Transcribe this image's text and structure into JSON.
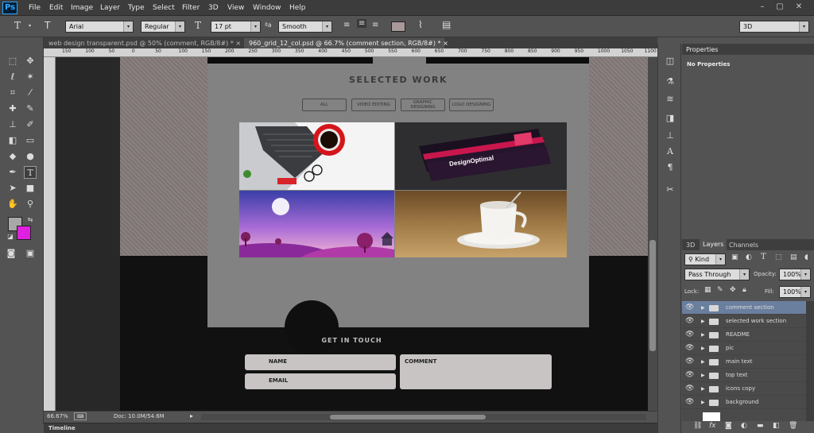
{
  "app": {
    "logo": "Ps"
  },
  "menu": [
    "File",
    "Edit",
    "Image",
    "Layer",
    "Type",
    "Select",
    "Filter",
    "3D",
    "View",
    "Window",
    "Help"
  ],
  "window_controls": [
    "–",
    "▢",
    "✕"
  ],
  "options": {
    "font_family": "Arial",
    "font_style": "Regular",
    "font_size": "17 pt",
    "antialias": "Smooth",
    "workspace": "3D"
  },
  "tabs": [
    {
      "label": "web design transparent.psd @ 50% (comment, RGB/8#) *",
      "close": "×"
    },
    {
      "label": "960_grid_12_col.psd @ 66.7% (comment section, RGB/8#) *",
      "close": "×"
    }
  ],
  "ruler_ticks": [
    "150",
    "100",
    "50",
    "0",
    "50",
    "100",
    "150",
    "200",
    "250",
    "300",
    "350",
    "400",
    "450",
    "500",
    "550",
    "600",
    "650",
    "700",
    "750",
    "800",
    "850",
    "900",
    "950",
    "1000",
    "1050",
    "1100"
  ],
  "document": {
    "section_title": "SELECTED WORK",
    "filters": [
      "ALL",
      "VIDEO EDITING",
      "GRAPHIC DESIGNING",
      "LOGO DESIGNING"
    ],
    "banner": "DesignOptimal",
    "get_in_touch": "GET IN TOUCH",
    "fields": {
      "name": "NAME",
      "email": "EMAIL",
      "comment": "COMMENT"
    }
  },
  "status": {
    "zoom": "66.67%",
    "doc": "Doc: 10.0M/54.6M"
  },
  "timeline": "Timeline",
  "properties": {
    "title": "Properties",
    "empty": "No Properties"
  },
  "layers_panel": {
    "tabs": [
      "3D",
      "Layers",
      "Channels"
    ],
    "kind": "Kind",
    "blend": "Pass Through",
    "opacity_label": "Opacity:",
    "opacity": "100%",
    "lock_label": "Lock:",
    "fill_label": "Fill:",
    "fill": "100%",
    "layers": [
      "comment section",
      "selected work section",
      "README",
      "pic",
      "main text",
      "top text",
      "icons copy",
      "background"
    ],
    "selected": "comment section",
    "bottom_icons": [
      "link-icon",
      "fx-icon",
      "mask-icon",
      "adjustment-icon",
      "group-icon",
      "new-layer-icon",
      "trash-icon"
    ]
  },
  "colors": {
    "foreground": "#a8a8a8",
    "background": "#e020e0",
    "selected_layer": "#6a7f9e",
    "accent": "#31a8ff"
  }
}
